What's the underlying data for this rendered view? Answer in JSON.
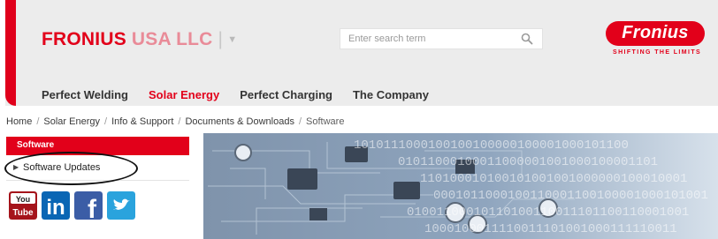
{
  "header": {
    "company_name": "FRONIUS",
    "company_suffix": "USA LLC",
    "company_sep": "|",
    "company_caret": "▼",
    "search_placeholder": "Enter search term",
    "logo_text": "Fronius",
    "tagline": "SHIFTING THE LIMITS",
    "brand_color": "#e2001a"
  },
  "nav": {
    "items": [
      "Perfect Welding",
      "Solar Energy",
      "Perfect Charging",
      "The Company"
    ],
    "active": "Solar Energy"
  },
  "breadcrumb": [
    "Home",
    "Solar Energy",
    "Info & Support",
    "Documents & Downloads",
    "Software"
  ],
  "sidebar": {
    "heading": "Software",
    "item_label": "Software Updates"
  },
  "social": {
    "icons": [
      "youtube-icon",
      "linkedin-icon",
      "facebook-icon",
      "twitter-icon"
    ],
    "youtube_label": "You\nTube",
    "linkedin_label": "in",
    "facebook_label": "f"
  },
  "hero": {
    "binary_lines": [
      "1010111000100100100000100001000101100",
      "01011000100011000001001000100001101",
      "110100010100101001001000000100010001",
      "0001011000100110001100100001000101001",
      "01001100010110100110011101100110001001",
      "1000100011110011101001000111110011"
    ]
  }
}
